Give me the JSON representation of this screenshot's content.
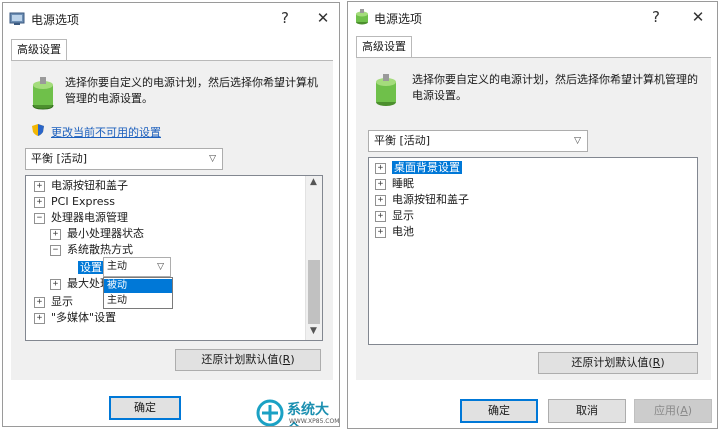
{
  "left_dialog": {
    "title": "电源选项",
    "help_glyph": "?",
    "close_glyph": "✕",
    "tab": "高级设置",
    "description": "选择你要自定义的电源计划，然后选择你希望计算机管理的电源设置。",
    "change_settings_link": "更改当前不可用的设置",
    "plan_combo": "平衡 [活动]",
    "tree": [
      {
        "label": "电源按钮和盖子",
        "expander": "⊞"
      },
      {
        "label": "PCI Express",
        "expander": "⊞"
      },
      {
        "label": "处理器电源管理",
        "expander": "⊟"
      },
      {
        "label": "最小处理器状态",
        "expander": "⊞"
      },
      {
        "label": "系统散热方式",
        "expander": "⊟"
      },
      {
        "label": "最大处理器状态",
        "expander": "⊞"
      },
      {
        "label": "显示",
        "expander": "⊞"
      },
      {
        "label": "\"多媒体\"设置",
        "expander": "⊞"
      }
    ],
    "setting_label": "设置:",
    "setting_value": "主动",
    "dropdown_options": [
      "被动",
      "主动"
    ],
    "restore_button": {
      "text": "还原计划默认值(",
      "mnemonic": "R",
      "suffix": ")"
    },
    "ok_button": "确定"
  },
  "right_dialog": {
    "title": "电源选项",
    "help_glyph": "?",
    "close_glyph": "✕",
    "tab": "高级设置",
    "description": "选择你要自定义的电源计划，然后选择你希望计算机管理的电源设置。",
    "plan_combo": "平衡 [活动]",
    "tree": [
      {
        "label": "桌面背景设置",
        "expander": "⊞"
      },
      {
        "label": "睡眠",
        "expander": "⊞"
      },
      {
        "label": "电源按钮和盖子",
        "expander": "⊞"
      },
      {
        "label": "显示",
        "expander": "⊞"
      },
      {
        "label": "电池",
        "expander": "⊞"
      }
    ],
    "restore_button": {
      "text": "还原计划默认值(",
      "mnemonic": "R",
      "suffix": ")"
    },
    "ok_button": "确定",
    "cancel_button": "取消",
    "apply_button": {
      "text": "应用(",
      "mnemonic": "A",
      "suffix": ")"
    }
  },
  "watermark": {
    "brand": "系统大全",
    "url": "WWW.XP85.COM"
  },
  "colors": {
    "accent": "#0078d7",
    "link": "#1b5fbd"
  }
}
